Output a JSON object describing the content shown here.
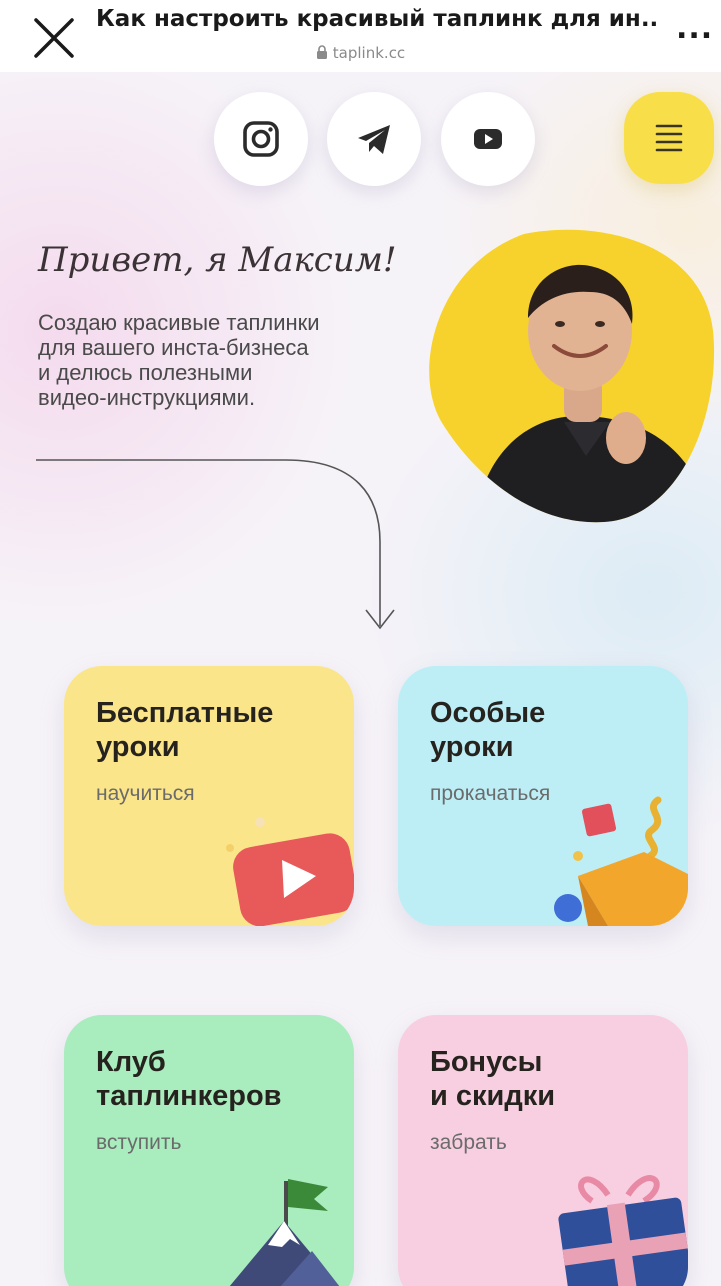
{
  "browser": {
    "title": "Как настроить красивый таплинк для ин...",
    "url": "taplink.cc",
    "more_label": "..."
  },
  "social": [
    {
      "name": "instagram",
      "icon": "instagram-icon"
    },
    {
      "name": "telegram",
      "icon": "telegram-icon"
    },
    {
      "name": "youtube",
      "icon": "youtube-icon"
    }
  ],
  "menu": {
    "icon": "hamburger-menu-icon"
  },
  "hero": {
    "greeting": "Привет, я Максим!",
    "intro_lines": [
      "Создаю красивые таплинки",
      "для вашего инста-бизнеса",
      "и делюсь полезными",
      "видео-инструкциями."
    ]
  },
  "cards": [
    {
      "title_lines": [
        "Бесплатные",
        "уроки"
      ],
      "subtitle": "научиться",
      "icon": "play-icon"
    },
    {
      "title_lines": [
        "Особые",
        "уроки"
      ],
      "subtitle": "прокачаться",
      "icon": "shapes-icon"
    },
    {
      "title_lines": [
        "Клуб",
        "таплинкеров"
      ],
      "subtitle": "вступить",
      "icon": "mountain-flag-icon"
    },
    {
      "title_lines": [
        "Бонусы",
        "и скидки"
      ],
      "subtitle": "забрать",
      "icon": "gift-icon"
    }
  ],
  "colors": {
    "accent_yellow": "#f8df4a",
    "card_yellow": "#fbe58a",
    "card_blue": "#bdeef6",
    "card_green": "#a9ecbe",
    "card_pink": "#f8cfe0"
  }
}
